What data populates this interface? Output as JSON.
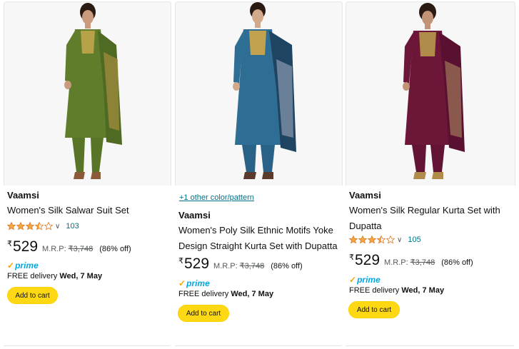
{
  "colors": {
    "star": "#f3a847",
    "link": "#007185",
    "button": "#ffd814",
    "prime": "#00a8e1"
  },
  "products": [
    {
      "garment_color": "olive-green",
      "brand": "Vaamsi",
      "title": "Women's Silk Salwar Suit Set",
      "rating": 3.5,
      "rating_count": "103",
      "currency": "₹",
      "price": "529",
      "mrp_label": "M.R.P:",
      "mrp": "₹3,748",
      "discount": "(86% off)",
      "prime": "prime",
      "delivery_label": "FREE delivery",
      "delivery_date": "Wed, 7 May",
      "cart_label": "Add to cart"
    },
    {
      "garment_color": "teal-blue",
      "color_link": "+1 other color/pattern",
      "brand": "Vaamsi",
      "title": "Women's Poly Silk Ethnic Motifs Yoke Design Straight Kurta Set with Dupatta",
      "currency": "₹",
      "price": "529",
      "mrp_label": "M.R.P:",
      "mrp": "₹3,748",
      "discount": "(86% off)",
      "prime": "prime",
      "delivery_label": "FREE delivery",
      "delivery_date": "Wed, 7 May",
      "cart_label": "Add to cart"
    },
    {
      "garment_color": "maroon",
      "brand": "Vaamsi",
      "title": "Women's Silk Regular Kurta Set with Dupatta",
      "rating": 3.5,
      "rating_count": "105",
      "currency": "₹",
      "price": "529",
      "mrp_label": "M.R.P:",
      "mrp": "₹3,748",
      "discount": "(86% off)",
      "prime": "prime",
      "delivery_label": "FREE delivery",
      "delivery_date": "Wed, 7 May",
      "cart_label": "Add to cart"
    }
  ]
}
